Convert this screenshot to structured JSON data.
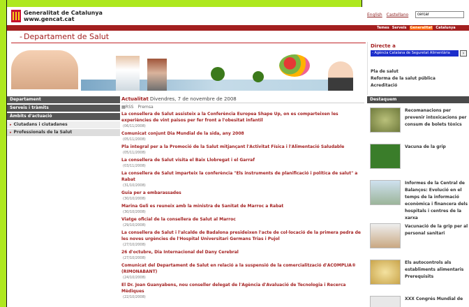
{
  "header": {
    "brand_line1": "Generalitat de Catalunya",
    "brand_line2": "www.gencat.cat",
    "lang_english": "English",
    "lang_castellano": "Castellano",
    "search_value": "cercar",
    "menu": [
      "Temes",
      "Serveis",
      "Generalitat",
      "Catalunya"
    ],
    "department": "Departament de Salut"
  },
  "directe": {
    "title": "Directe a",
    "selected": "- Agència Catalana de Seguretat Alimentària",
    "links": [
      "Pla de salut",
      "Reforma de la salut pública",
      "Acreditació"
    ]
  },
  "destaquem": {
    "title": "Destaquem",
    "items": [
      "Recomanacions per prevenir intoxicacions per consum de bolets tòxics",
      "Vacuna de la grip",
      "Informes de la Central de Balanços: Evolució en el temps de la informació econòmica i financera dels hospitals i centres de la xarxa",
      "Vacunació de la grip per al personal sanitari",
      "Els autocontrols als establiments alimentaris Prerequisits",
      "XXX Congrés Mundial de"
    ]
  },
  "nav": {
    "departament": "Departament",
    "serveis": "Serveis i tràmits",
    "ambit": "Àmbits d'actuació",
    "items": [
      "Ciutadans i ciutadanes",
      "Professionals de la Salut"
    ]
  },
  "main": {
    "actualitat": "Actualitat",
    "date": "Divendres, 7 de novembre de 2008",
    "rss": "RSS",
    "premsa": "Premsa",
    "news": [
      {
        "title": "La consellera de Salut assisteix a la Conferència Europea Shape Up, on es comparteixen les experiències de vint països per fer front a l'obesitat infantil",
        "date": "(06/11/2008)"
      },
      {
        "title": "Comunicat conjunt Dia Mundial de la sida, any 2008",
        "date": "(05/11/2008)"
      },
      {
        "title": "Pla integral per a la Promoció de la Salut mitjançant l'Activitat Física i l'Alimentació Saludable",
        "date": "(05/11/2008)"
      },
      {
        "title": "La consellera de Salut visita el Baix Llobregat i el Garraf",
        "date": "(03/11/2008)"
      },
      {
        "title": "La consellera de Salut imparteix la conferència \"Els instruments de planificació i política de salut\" a Rabat",
        "date": "(31/10/2008)"
      },
      {
        "title": "Guia per a embarassades",
        "date": "(30/10/2008)"
      },
      {
        "title": "Marina Geli es reuneix amb la ministra de Sanitat de Marroc a Rabat",
        "date": "(30/10/2008)"
      },
      {
        "title": "Viatge oficial de la consellera de Salut al Marroc",
        "date": "(29/10/2008)"
      },
      {
        "title": "La consellera de Salut i l'alcalde de Badalona presideixen l'acte de col·locació de la primera pedra de les noves urgències de l'Hospital Universitari Germans Trias i Pujol",
        "date": "(27/10/2008)"
      },
      {
        "title": "26 d'octubre, Dia Internacional del Dany Cerebral",
        "date": "(27/10/2008)"
      },
      {
        "title": "Comunicat del Departament de Salut en relació a la suspensió de la comercialització d'ACOMPLIA® (RIMONABANT)",
        "date": "(24/10/2008)"
      },
      {
        "title": "El Dr. Joan Guanyabens, nou conseller delegat de l'Agència d'Avaluació de Tecnologia i Recerca Mèdiques",
        "date": "(22/10/2008)"
      }
    ]
  }
}
